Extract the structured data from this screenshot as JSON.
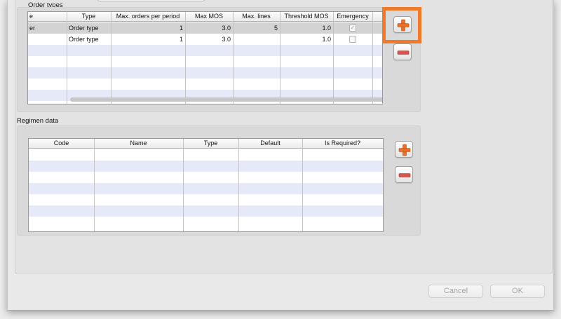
{
  "order_types": {
    "label": "Order types",
    "columns": [
      "e",
      "Type",
      "Max. orders per period",
      "Max MOS",
      "Max. lines",
      "Threshold MOS",
      "Emergency"
    ],
    "rows": [
      {
        "name": "er",
        "type": "Order type",
        "max_orders": "1",
        "max_mos": "3.0",
        "max_lines": "5",
        "threshold_mos": "1.0",
        "emergency": true
      },
      {
        "name": "",
        "type": "Order type",
        "max_orders": "1",
        "max_mos": "3.0",
        "max_lines": "",
        "threshold_mos": "1.0",
        "emergency": false
      }
    ],
    "add_icon": "plus-icon",
    "remove_icon": "minus-icon"
  },
  "regimen_data": {
    "label": "Regimen data",
    "columns": [
      "Code",
      "Name",
      "Type",
      "Default",
      "Is Required?"
    ],
    "rows": [],
    "add_icon": "plus-icon",
    "remove_icon": "minus-icon"
  },
  "footer": {
    "cancel_label": "Cancel",
    "ok_label": "OK"
  },
  "colors": {
    "highlight": "#ef7a2a",
    "plus": "#e8702a",
    "minus": "#d9534f",
    "row_stripe": "#e6eaf8",
    "selected_row": "#d3d3d3"
  }
}
